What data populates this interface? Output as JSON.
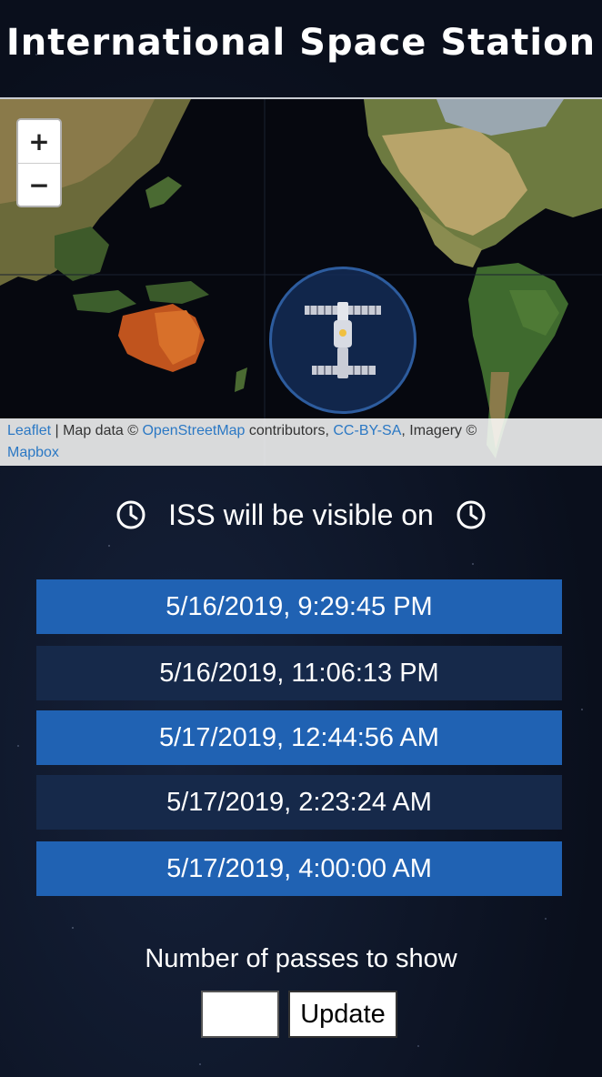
{
  "app": {
    "title": "International Space Station"
  },
  "map": {
    "zoom_in_label": "+",
    "zoom_out_label": "−",
    "attribution": {
      "leaflet": "Leaflet",
      "separator": " | Map data © ",
      "osm": "OpenStreetMap",
      "contributors": " contributors, ",
      "license": "CC-BY-SA",
      "imagery": ", Imagery © ",
      "mapbox": "Mapbox"
    },
    "marker_icon": "space-station-icon"
  },
  "visibility": {
    "heading": "ISS will be visible on",
    "icon": "clock-icon",
    "passes": [
      "5/16/2019, 9:29:45 PM",
      "5/16/2019, 11:06:13 PM",
      "5/17/2019, 12:44:56 AM",
      "5/17/2019, 2:23:24 AM",
      "5/17/2019, 4:00:00 AM"
    ]
  },
  "form": {
    "label": "Number of passes to show",
    "input_value": "",
    "update_label": "Update"
  },
  "colors": {
    "pass_light": "#2062b3",
    "pass_dark": "#16294a",
    "link": "#2b78c4"
  }
}
